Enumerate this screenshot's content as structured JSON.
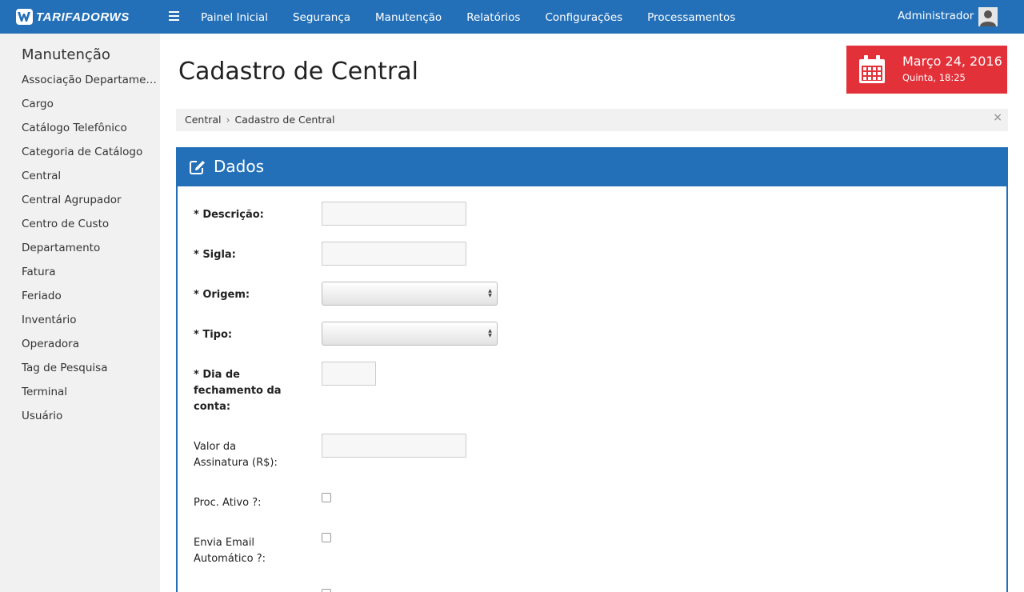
{
  "app": {
    "logo_text": "TARIFADORWS"
  },
  "nav": {
    "items": [
      "Painel Inicial",
      "Segurança",
      "Manutenção",
      "Relatórios",
      "Configurações",
      "Processamentos"
    ]
  },
  "user": {
    "name": "Administrador"
  },
  "sidebar": {
    "title": "Manutenção",
    "items": [
      "Associação Departamento ...",
      "Cargo",
      "Catálogo Telefônico",
      "Categoria de Catálogo",
      "Central",
      "Central Agrupador",
      "Centro de Custo",
      "Departamento",
      "Fatura",
      "Feriado",
      "Inventário",
      "Operadora",
      "Tag de Pesquisa",
      "Terminal",
      "Usuário"
    ]
  },
  "page": {
    "title": "Cadastro de Central"
  },
  "date_box": {
    "date": "Março 24, 2016",
    "weekday_time": "Quinta, 18:25",
    "color": "#e3313a"
  },
  "breadcrumb": {
    "items": [
      "Central",
      "Cadastro de Central"
    ],
    "separator": "›",
    "close_symbol": "×"
  },
  "panel": {
    "title": "Dados",
    "icon": "edit-icon",
    "color": "#2470b8"
  },
  "form": {
    "descricao": {
      "label": "* Descrição:",
      "value": ""
    },
    "sigla": {
      "label": "* Sigla:",
      "value": ""
    },
    "origem": {
      "label": "* Origem:",
      "selected": ""
    },
    "tipo": {
      "label": "* Tipo:",
      "selected": ""
    },
    "dia_fechamento": {
      "label": "* Dia de fechamento da conta:",
      "value": ""
    },
    "valor_assinatura": {
      "label": "Valor da Assinatura (R$):",
      "value": ""
    },
    "proc_ativo": {
      "label": "Proc. Ativo ?:",
      "checked": false
    },
    "envia_email": {
      "label": "Envia Email Automático ?:",
      "checked": false
    }
  }
}
